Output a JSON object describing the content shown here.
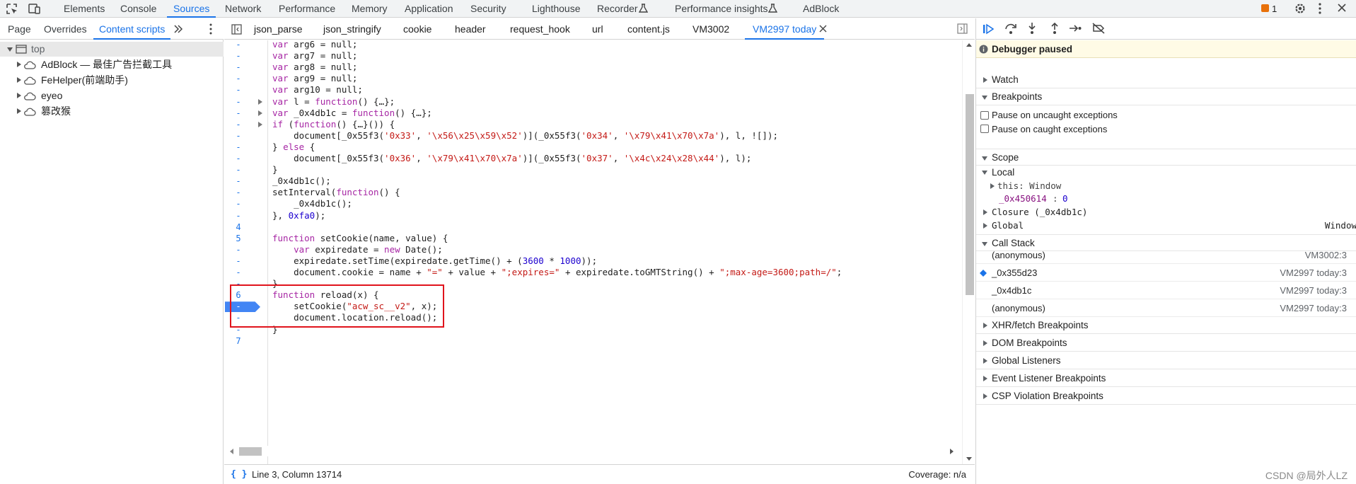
{
  "topbar": {
    "tabs": [
      "Elements",
      "Console",
      "Sources",
      "Network",
      "Performance",
      "Memory",
      "Application",
      "Security",
      "Lighthouse",
      "Recorder",
      "Performance insights",
      "AdBlock"
    ],
    "issue_count": "1"
  },
  "left": {
    "tabs": [
      "Page",
      "Overrides",
      "Content scripts"
    ],
    "tree": [
      "top",
      "AdBlock — 最佳广告拦截工具",
      "FeHelper(前端助手)",
      "eyeo",
      "篡改猴"
    ]
  },
  "editor": {
    "tabs": [
      "json_parse",
      "json_stringify",
      "cookie",
      "header",
      "request_hook",
      "url",
      "content.js",
      "VM3002",
      "VM2997 today"
    ],
    "line_numbers": [
      "-",
      "-",
      "-",
      "-",
      "-",
      "-",
      "-",
      "-",
      "-",
      "-",
      "-",
      "-",
      "-",
      "-",
      "-",
      "-",
      "4",
      "5",
      "-",
      "-",
      "-",
      "-",
      "6",
      "-",
      "-",
      "-",
      "7"
    ],
    "code": [
      "var arg6 = null;",
      "var arg7 = null;",
      "var arg8 = null;",
      "var arg9 = null;",
      "var arg10 = null;",
      "var l = function() {…};",
      "var _0x4db1c = function() {…};",
      "if (function() {…}()) {",
      "    document[_0x55f3('0x33', '\\x56\\x25\\x59\\x52')](_0x55f3('0x34', '\\x79\\x41\\x70\\x7a'), l, ![]);",
      "} else {",
      "    document[_0x55f3('0x36', '\\x79\\x41\\x70\\x7a')](_0x55f3('0x37', '\\x4c\\x24\\x28\\x44'), l);",
      "}",
      "_0x4db1c();",
      "setInterval(function() {",
      "    _0x4db1c();",
      "}, 0xfa0);",
      "",
      "function setCookie(name, value) {",
      "    var expiredate = new Date();",
      "    expiredate.setTime(expiredate.getTime() + (3600 * 1000));",
      "    document.cookie = name + \"=\" + value + \";expires=\" + expiredate.toGMTString() + \";max-age=3600;path=/\";",
      "}",
      "function reload(x) {",
      "    setCookie(\"acw_sc__v2\", x);",
      "    document.location.reload();",
      "}",
      ""
    ],
    "status_position": "Line 3, Column 13714",
    "coverage": "Coverage: n/a"
  },
  "debugger": {
    "paused_label": "Debugger paused",
    "watch": "Watch",
    "breakpoints": "Breakpoints",
    "pause_uncaught": "Pause on uncaught exceptions",
    "pause_caught": "Pause on caught exceptions",
    "scope": "Scope",
    "local": "Local",
    "this_label": "this: Window",
    "var_name": "_0x450614",
    "var_value": "0",
    "closure": "Closure (_0x4db1c)",
    "global": "Global",
    "global_value": "Window",
    "call_stack": "Call Stack",
    "frames": [
      {
        "name": "(anonymous)",
        "loc": "VM3002:3"
      },
      {
        "name": "_0x355d23",
        "loc": "VM2997 today:3"
      },
      {
        "name": "_0x4db1c",
        "loc": "VM2997 today:3"
      },
      {
        "name": "(anonymous)",
        "loc": "VM2997 today:3"
      }
    ],
    "sections": [
      "XHR/fetch Breakpoints",
      "DOM Breakpoints",
      "Global Listeners",
      "Event Listener Breakpoints",
      "CSP Violation Breakpoints"
    ]
  },
  "watermark": "CSDN @局外人LZ",
  "colors": {
    "accent": "#1a73e8",
    "breakpoint": "#4285f4",
    "highlight_box": "#e0141c",
    "paused_bg": "#fffbe6"
  }
}
